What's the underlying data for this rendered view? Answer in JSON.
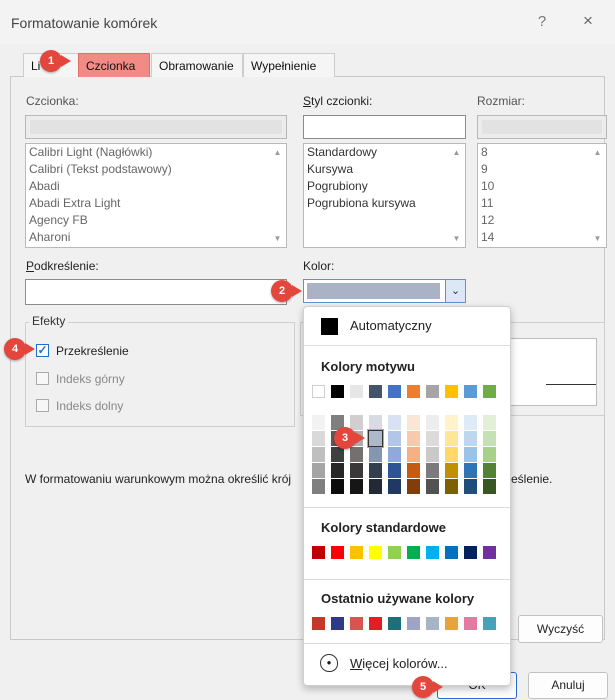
{
  "dialog": {
    "title": "Formatowanie komórek",
    "help": "?",
    "close": "×"
  },
  "tabs": [
    {
      "label": "Liczby",
      "visible_text": "Li"
    },
    {
      "label": "Czcionka"
    },
    {
      "label": "Obramowanie"
    },
    {
      "label": "Wypełnienie"
    }
  ],
  "font": {
    "label": "Czcionka:",
    "value": "",
    "items": [
      "Calibri Light (Nagłówki)",
      "Calibri (Tekst podstawowy)",
      "Abadi",
      "Abadi Extra Light",
      "Agency FB",
      "Aharoni"
    ]
  },
  "style": {
    "label": "Styl czcionki:",
    "value": "",
    "items": [
      "Standardowy",
      "Kursywa",
      "Pogrubiony",
      "Pogrubiona kursywa"
    ]
  },
  "size": {
    "label": "Rozmiar:",
    "value": "",
    "items": [
      "8",
      "9",
      "10",
      "11",
      "12",
      "14"
    ]
  },
  "underline": {
    "label": "Podkreślenie:",
    "value": ""
  },
  "color": {
    "label": "Kolor:",
    "selected_hex": "#aab3c5"
  },
  "effects": {
    "title": "Efekty",
    "strikethrough": {
      "label": "Przekreślenie",
      "checked": true
    },
    "superscript": {
      "label": "Indeks górny",
      "checked": false
    },
    "subscript": {
      "label": "Indeks dolny",
      "checked": false
    }
  },
  "hint": {
    "left": "W formatowaniu warunkowym można określić krój",
    "right": "eślenie."
  },
  "buttons": {
    "clear": "Wyczyść",
    "ok": "OK",
    "cancel": "Anuluj"
  },
  "badges": [
    "1",
    "2",
    "3",
    "4",
    "5"
  ],
  "popup": {
    "automatic": "Automatyczny",
    "theme_title": "Kolory motywu",
    "standard_title": "Kolory standardowe",
    "recent_title": "Ostatnio używane kolory",
    "more": "Więcej kolorów...",
    "theme_top": [
      "#ffffff",
      "#000000",
      "#e7e6e6",
      "#44546a",
      "#4472c4",
      "#ed7d31",
      "#a5a5a5",
      "#ffc000",
      "#5b9bd5",
      "#70ad47"
    ],
    "theme_shades": [
      [
        "#f2f2f2",
        "#7f7f7f",
        "#d0cece",
        "#d6dce4",
        "#d9e2f3",
        "#fbe5d5",
        "#ededed",
        "#fff2cc",
        "#deebf6",
        "#e2efd9"
      ],
      [
        "#d9d9d9",
        "#595959",
        "#aeabab",
        "#adb9ca",
        "#b4c6e7",
        "#f7caac",
        "#dbdbdb",
        "#ffe598",
        "#bdd7ee",
        "#c5e0b3"
      ],
      [
        "#bfbfbf",
        "#3f3f3f",
        "#757070",
        "#8496b0",
        "#8eaadb",
        "#f4b183",
        "#c9c9c9",
        "#ffd965",
        "#9cc2e5",
        "#a8d08d"
      ],
      [
        "#a5a5a5",
        "#262626",
        "#3a3838",
        "#323f4f",
        "#2f5496",
        "#c55a11",
        "#7b7b7b",
        "#bf9000",
        "#2e75b5",
        "#538135"
      ],
      [
        "#7f7f7f",
        "#0c0c0c",
        "#171616",
        "#222a35",
        "#1f3864",
        "#833c0b",
        "#525252",
        "#7f6000",
        "#1e4e79",
        "#375623"
      ]
    ],
    "selected": {
      "row": 1,
      "col": 3
    },
    "standard": [
      "#c00000",
      "#ff0000",
      "#ffc000",
      "#ffff00",
      "#92d050",
      "#00b050",
      "#00b0f0",
      "#0070c0",
      "#002060",
      "#7030a0"
    ],
    "recent": [
      "#c0392b",
      "#2e3a87",
      "#d9534f",
      "#e01e24",
      "#1f6f7a",
      "#9ea4c5",
      "#a6b4c8",
      "#e8a33a",
      "#e07ca0",
      "#4aa0b8"
    ]
  }
}
